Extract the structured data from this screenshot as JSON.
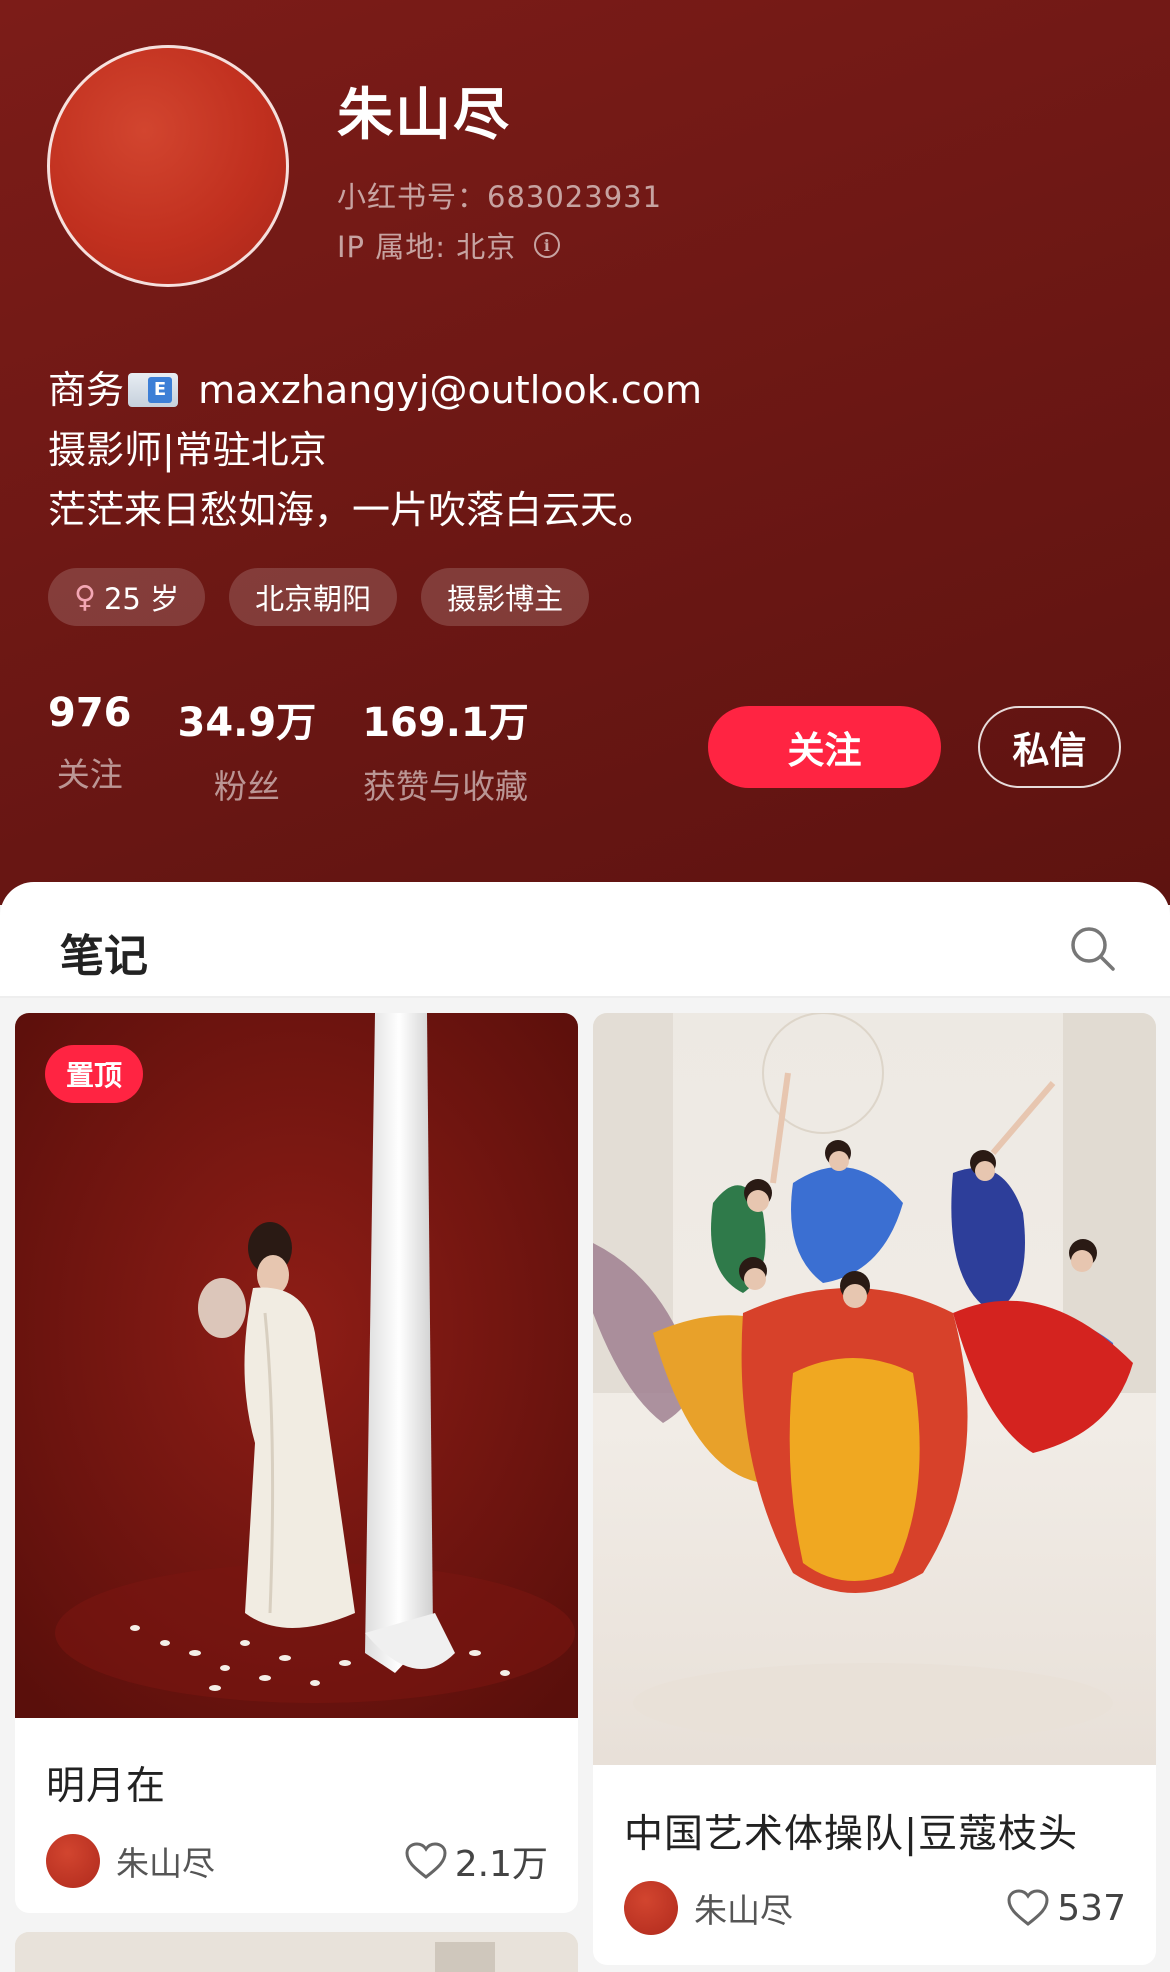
{
  "profile": {
    "name": "朱山尽",
    "id_text": "小红书号：683023931",
    "ip_text": "IP 属地: 北京",
    "bio_lines": {
      "line1_prefix": "商务",
      "line1_email": "maxzhangyj@outlook.com",
      "line2": "摄影师|常驻北京",
      "line3": "茫茫来日愁如海，一片吹落白云天。"
    },
    "mail_icon_letter": "E",
    "tags": [
      {
        "icon": "female-icon",
        "symbol": "♀",
        "label": "25 岁"
      },
      {
        "label": "北京朝阳"
      },
      {
        "label": "摄影博主"
      }
    ],
    "stats": [
      {
        "value": "976",
        "label": "关注"
      },
      {
        "value": "34.9万",
        "label": "粉丝"
      },
      {
        "value": "169.1万",
        "label": "获赞与收藏"
      }
    ],
    "follow_label": "关注",
    "message_label": "私信"
  },
  "tabs": {
    "notes_label": "笔记"
  },
  "notes": [
    {
      "pinned_label": "置顶",
      "title": "明月在",
      "author": "朱山尽",
      "likes": "2.1万"
    },
    {
      "title": "中国艺术体操队|豆蔻枝头",
      "author": "朱山尽",
      "likes": "537"
    }
  ],
  "colors": {
    "header_bg": "#6b1714",
    "accent": "#ff2442",
    "avatar": "#c1301f"
  }
}
